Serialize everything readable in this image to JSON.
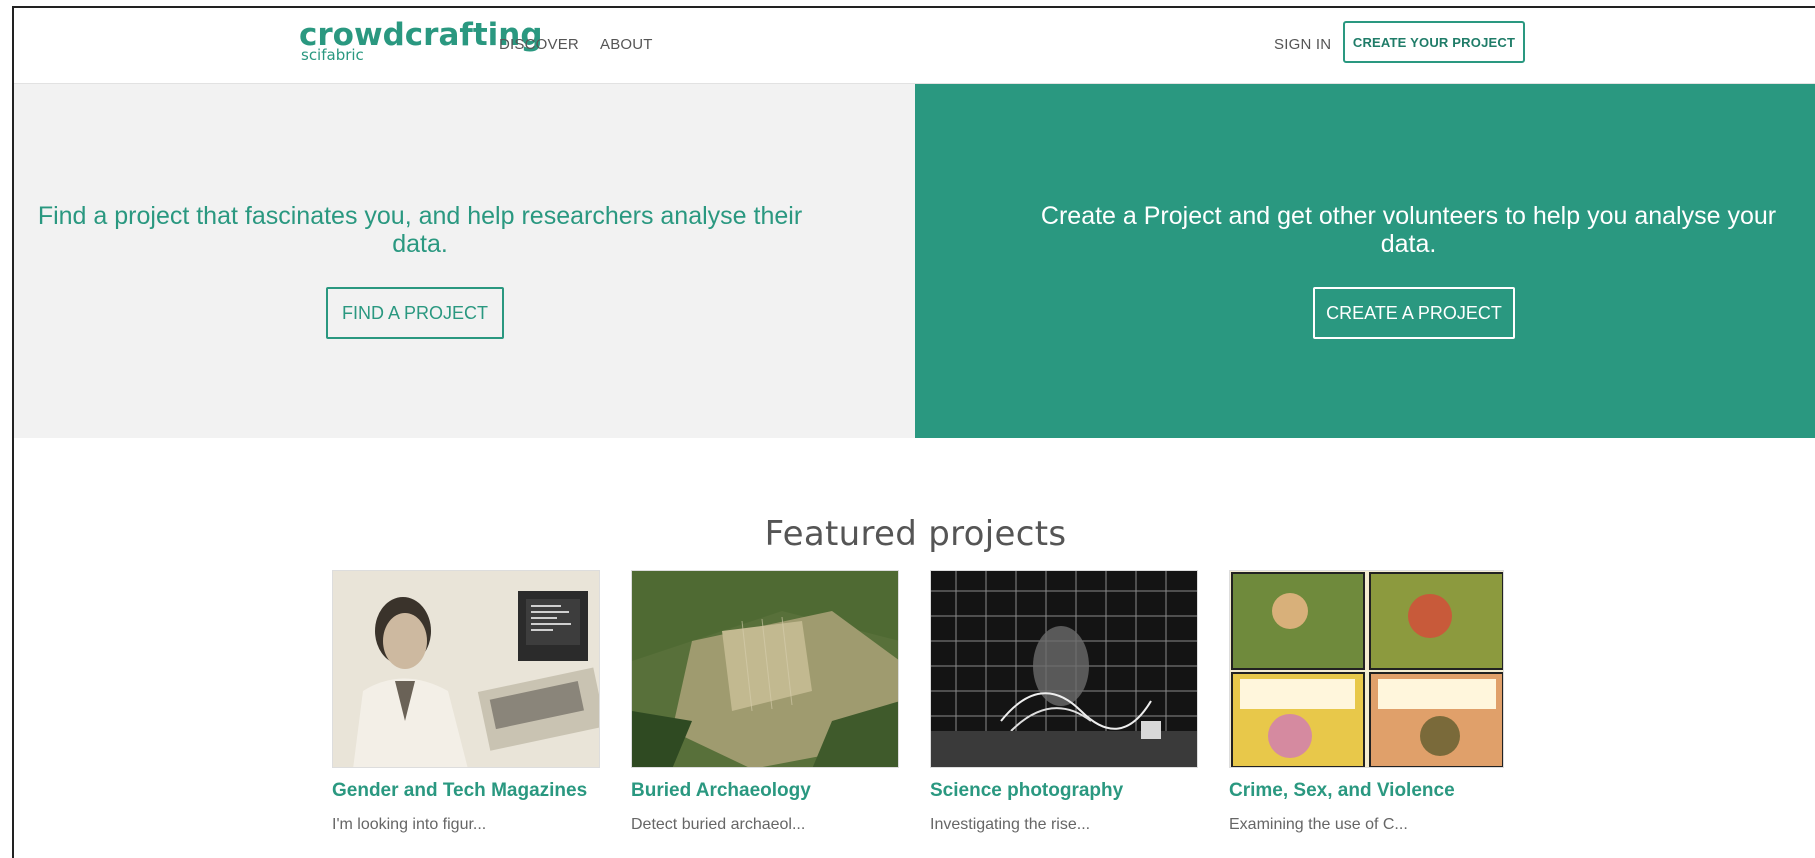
{
  "nav": {
    "logo_main": "crowdcrafting",
    "logo_sub": "scifabric",
    "discover": "DISCOVER",
    "about": "ABOUT",
    "sign_in": "SIGN IN",
    "create_project": "CREATE YOUR PROJECT"
  },
  "hero": {
    "left_text": "Find a project that fascinates you, and help researchers analyse their data.",
    "left_button": "FIND A PROJECT",
    "right_text": "Create a Project and get other volunteers to help you analyse your data.",
    "right_button": "CREATE A PROJECT"
  },
  "featured": {
    "title": "Featured projects",
    "projects": [
      {
        "title": "Gender and Tech Magazines",
        "description": "I'm looking into figur..."
      },
      {
        "title": "Buried Archaeology",
        "description": "Detect buried archaeol..."
      },
      {
        "title": "Science photography",
        "description": "Investigating the rise..."
      },
      {
        "title": "Crime, Sex, and Violence",
        "description": "Examining the use of C..."
      }
    ]
  },
  "colors": {
    "accent": "#2a9880",
    "hero_left_bg": "#f2f2f2"
  }
}
